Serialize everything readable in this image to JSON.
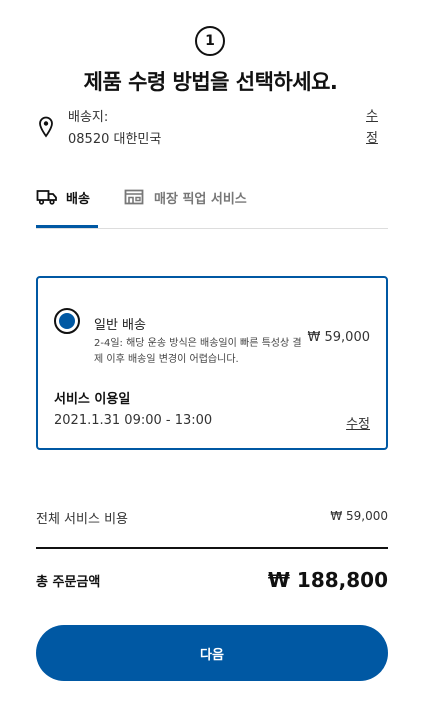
{
  "step": {
    "number": "1"
  },
  "header": {
    "title": "제품 수령 방법을 선택하세요."
  },
  "address": {
    "label": "배송지:",
    "value": "08520 대한민국",
    "edit_label": "수정"
  },
  "tabs": [
    {
      "label": "배송",
      "icon": "truck-icon",
      "active": true
    },
    {
      "label": "매장 픽업 서비스",
      "icon": "store-icon",
      "active": false
    }
  ],
  "delivery_option": {
    "name": "일반 배송",
    "description": "2-4일: 해당 운송 방식은 배송일이 빠른 특성상 결제 이후 배송일 변경이 어렵습니다.",
    "price": "₩ 59,000",
    "selected": true,
    "service_date_label": "서비스 이용일",
    "service_date": "2021.1.31 09:00 - 13:00",
    "edit_label": "수정"
  },
  "summary": {
    "service_total_label": "전체 서비스 비용",
    "service_total_value": "₩ 59,000",
    "order_total_label": "총 주문금액",
    "order_total_value": "₩ 188,800"
  },
  "next_button": {
    "label": "다음"
  },
  "colors": {
    "accent": "#0058a3",
    "text": "#111111"
  }
}
